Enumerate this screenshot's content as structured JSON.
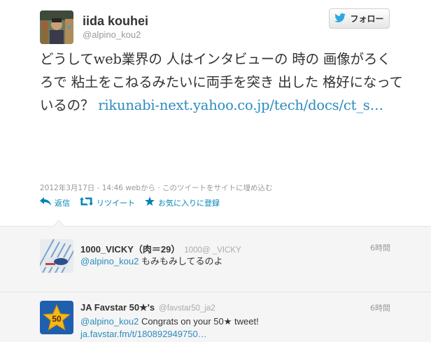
{
  "tweet": {
    "display_name": "iida kouhei",
    "screen_name": "@alpino_kou2",
    "follow_label": "フォロー",
    "text_main": "どうしてweb業界の 人はインタビューの 時の 画像がろくろで 粘土をこねるみたいに両手を突き 出した 格好になっているの？ ",
    "link": "rikunabi-next.yahoo.co.jp/tech/docs/ct_s…",
    "meta": "2012年3月17日 - 14:46 webから · このツイートをサイトに埋め込む",
    "actions": {
      "reply": "返信",
      "retweet": "リツイート",
      "favorite": "お気に入りに登録"
    }
  },
  "replies": [
    {
      "name": "1000_VICKY（肉＝29）",
      "screen": "1000@ _VICKY",
      "time": "6時間",
      "mention": "@alpino_kou2",
      "text": " もみもみしてるのよ"
    },
    {
      "name": "JA Favstar 50★'s",
      "screen": "@favstar50_ja2",
      "time": "6時間",
      "mention": "@alpino_kou2",
      "text": " Congrats on your 50★ tweet!",
      "link": "ja.favstar.fm/t/180892949750…",
      "badge": "50"
    }
  ],
  "colors": {
    "link": "#2a8bbf",
    "action": "#0084b4",
    "muted": "#999999",
    "reply_bg": "#f5f5f5"
  }
}
